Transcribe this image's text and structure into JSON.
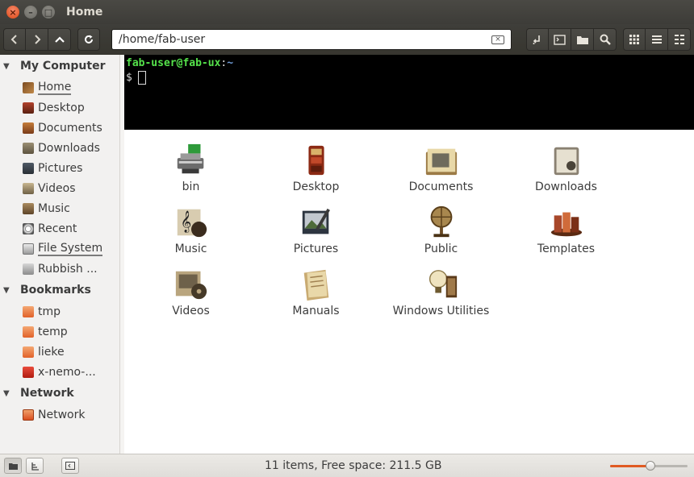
{
  "window": {
    "title": "Home"
  },
  "toolbar": {
    "location": "/home/fab-user",
    "icons": [
      "go-back-icon",
      "go-forward-icon",
      "go-up-icon",
      "reload-icon",
      "clear-location-icon",
      "open-terminal-icon",
      "terminal-icon",
      "folder-icon",
      "search-icon",
      "icon-view-icon",
      "list-view-icon",
      "compact-view-icon"
    ]
  },
  "sidebar": {
    "sections": [
      {
        "title": "My Computer",
        "items": [
          {
            "label": "Home",
            "icon": "home",
            "underlined": true
          },
          {
            "label": "Desktop",
            "icon": "desktop"
          },
          {
            "label": "Documents",
            "icon": "docs"
          },
          {
            "label": "Downloads",
            "icon": "down"
          },
          {
            "label": "Pictures",
            "icon": "pics"
          },
          {
            "label": "Videos",
            "icon": "vids"
          },
          {
            "label": "Music",
            "icon": "music"
          },
          {
            "label": "Recent",
            "icon": "recent"
          },
          {
            "label": "File System",
            "icon": "fs",
            "underlined": true
          },
          {
            "label": "Rubbish ...",
            "icon": "trash"
          }
        ]
      },
      {
        "title": "Bookmarks",
        "items": [
          {
            "label": "tmp",
            "icon": "folder"
          },
          {
            "label": "temp",
            "icon": "folder"
          },
          {
            "label": "lieke",
            "icon": "folder"
          },
          {
            "label": "x-nemo-...",
            "icon": "xnemo"
          }
        ]
      },
      {
        "title": "Network",
        "items": [
          {
            "label": "Network",
            "icon": "net"
          }
        ]
      }
    ]
  },
  "terminal": {
    "user_host": "fab-user@fab-ux",
    "separator": ":",
    "path": "~",
    "prompt": "$"
  },
  "files": [
    {
      "label": "bin",
      "icon": "bin"
    },
    {
      "label": "Desktop",
      "icon": "desktop"
    },
    {
      "label": "Documents",
      "icon": "documents"
    },
    {
      "label": "Downloads",
      "icon": "downloads"
    },
    {
      "label": "Music",
      "icon": "music"
    },
    {
      "label": "Pictures",
      "icon": "pictures"
    },
    {
      "label": "Public",
      "icon": "public"
    },
    {
      "label": "Templates",
      "icon": "templates"
    },
    {
      "label": "Videos",
      "icon": "videos"
    },
    {
      "label": "Manuals",
      "icon": "manuals"
    },
    {
      "label": "Windows Utilities",
      "icon": "windows-utilities"
    }
  ],
  "statusbar": {
    "text": "11 items, Free space: 211.5 GB",
    "zoom_level": 0.52
  }
}
